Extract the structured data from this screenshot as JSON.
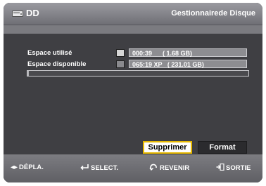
{
  "titlebar": {
    "disc_label": "DD",
    "title": "Gestionnairede Disque"
  },
  "rows": [
    {
      "label": "Espace utilisé",
      "value": "000:39      ( 1.68 GB)",
      "swatch_color": "#d7d7d7"
    },
    {
      "label": "Espace disponible",
      "value": "065:19 XP   ( 231.01 GB)",
      "swatch_color": "#8a8a8e"
    }
  ],
  "usage": {
    "used_fraction": 0.007
  },
  "buttons": {
    "delete": "Supprimer",
    "format": "Format"
  },
  "footer": {
    "move": "DÉPLA.",
    "select": "SELECT.",
    "back": "REVENIR",
    "exit": "SORTIE"
  },
  "icons": {
    "disc": "hdd-icon",
    "move": "left-right-arrows-icon",
    "select": "enter-icon",
    "back": "return-icon",
    "exit": "exit-icon"
  }
}
